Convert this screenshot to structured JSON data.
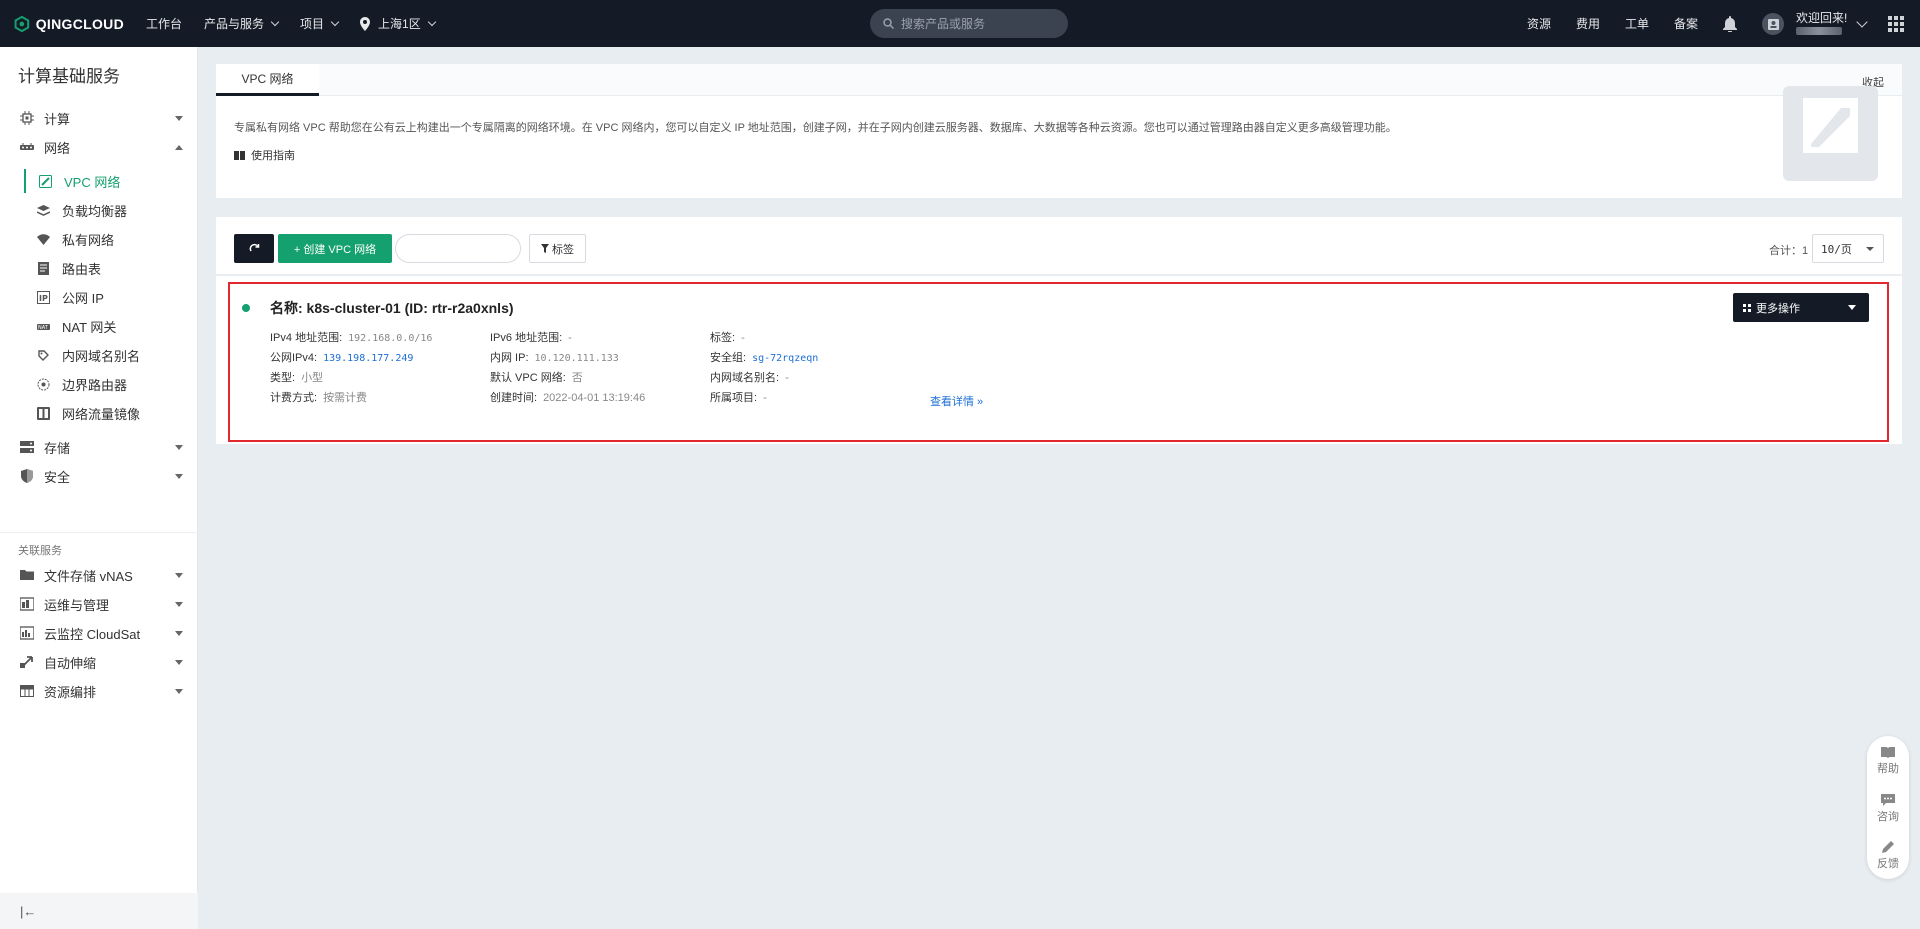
{
  "topbar": {
    "brand": "QINGCLOUD",
    "nav": [
      "工作台",
      "产品与服务",
      "项目"
    ],
    "region": "上海1区",
    "search_placeholder": "搜索产品或服务",
    "links": [
      "资源",
      "费用",
      "工单",
      "备案"
    ],
    "welcome": "欢迎回来!"
  },
  "sidebar": {
    "title": "计算基础服务",
    "groups": [
      {
        "label": "计算"
      },
      {
        "label": "网络"
      }
    ],
    "network_items": [
      "VPC 网络",
      "负载均衡器",
      "私有网络",
      "路由表",
      "公网 IP",
      "NAT 网关",
      "内网域名别名",
      "边界路由器",
      "网络流量镜像"
    ],
    "groups_after": [
      "存储",
      "安全"
    ],
    "related_caption": "关联服务",
    "related": [
      "文件存储 vNAS",
      "运维与管理",
      "云监控 CloudSat",
      "自动伸缩",
      "资源编排"
    ],
    "collapse_glyph": "|←"
  },
  "intro": {
    "tab": "VPC 网络",
    "collapse": "收起",
    "description": "专属私有网络 VPC 帮助您在公有云上构建出一个专属隔离的网络环境。在 VPC 网络内，您可以自定义 IP 地址范围，创建子网，并在子网内创建云服务器、数据库、大数据等各种云资源。您也可以通过管理路由器自定义更多高级管理功能。",
    "guide": "使用指南"
  },
  "toolbar": {
    "create_label": "+ 创建 VPC 网络",
    "tag_label": "标签",
    "total_label": "合计：1",
    "page_size": "10/页"
  },
  "vpc": {
    "title": "名称: k8s-cluster-01 (ID: rtr-r2a0xnls)",
    "more_label": "更多操作",
    "col1": [
      {
        "label": "IPv4 地址范围:",
        "value": "192.168.0.0/16"
      },
      {
        "label": "公网IPv4:",
        "value": "139.198.177.249"
      },
      {
        "label": "类型:",
        "value": "小型"
      },
      {
        "label": "计费方式:",
        "value": "按需计费"
      }
    ],
    "col2": [
      {
        "label": "IPv6 地址范围:",
        "value": "-"
      },
      {
        "label": "内网 IP:",
        "value": "10.120.111.133"
      },
      {
        "label": "默认 VPC 网络:",
        "value": "否"
      },
      {
        "label": "创建时间:",
        "value": "2022-04-01 13:19:46"
      }
    ],
    "col3": [
      {
        "label": "标签:",
        "value": "-"
      },
      {
        "label": "安全组:",
        "value": "sg-72rqzeqn"
      },
      {
        "label": "内网域名别名:",
        "value": "-"
      },
      {
        "label": "所属项目:",
        "value": "-"
      }
    ],
    "detail_link": "查看详情 »"
  },
  "float_help": [
    "帮助",
    "咨询",
    "反馈"
  ],
  "colors": {
    "accent": "#14a06f",
    "dark": "#151b26",
    "highlight": "#e0282e",
    "link": "#1d6fd6"
  }
}
